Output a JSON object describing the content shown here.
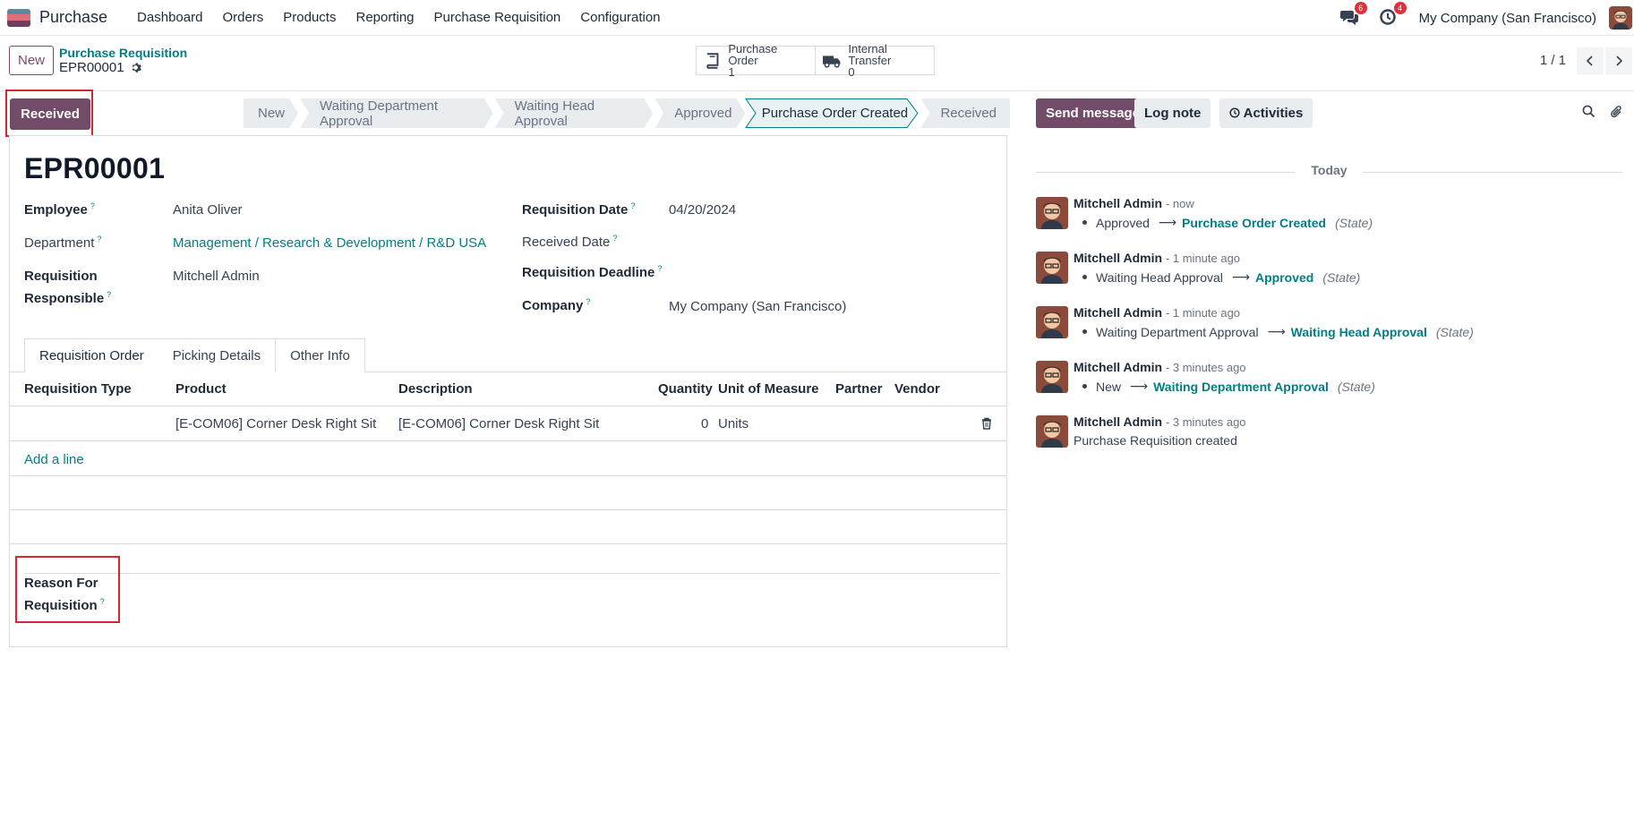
{
  "navbar": {
    "app_name": "Purchase",
    "menu": [
      "Dashboard",
      "Orders",
      "Products",
      "Reporting",
      "Purchase Requisition",
      "Configuration"
    ],
    "messages_count": "6",
    "activities_count": "4",
    "company": "My Company (San Francisco)"
  },
  "control": {
    "new_label": "New",
    "breadcrumb_parent": "Purchase Requisition",
    "breadcrumb_current": "EPR00001",
    "smart_buttons": [
      {
        "label": "Purchase Order",
        "count": "1",
        "icon": "book-icon"
      },
      {
        "label": "Internal Transfer",
        "count": "0",
        "icon": "truck-icon"
      }
    ],
    "pager": "1 / 1"
  },
  "statusbar": {
    "action_label": "Received",
    "stages": [
      "New",
      "Waiting Department Approval",
      "Waiting Head Approval",
      "Approved",
      "Purchase Order Created",
      "Received"
    ],
    "active_stage": "Purchase Order Created"
  },
  "form": {
    "title": "EPR00001",
    "employee_label": "Employee",
    "employee": "Anita Oliver",
    "department_label": "Department",
    "department": "Management / Research & Development / R&D USA",
    "responsible_label_1": "Requisition",
    "responsible_label_2": "Responsible",
    "responsible": "Mitchell Admin",
    "req_date_label": "Requisition Date",
    "req_date": "04/20/2024",
    "received_date_label": "Received Date",
    "deadline_label": "Requisition Deadline",
    "company_label": "Company",
    "company": "My Company (San Francisco)",
    "help_mark": "?",
    "tabs": [
      "Requisition Order",
      "Picking Details",
      "Other Info"
    ],
    "columns": [
      "Requisition Type",
      "Product",
      "Description",
      "Quantity",
      "Unit of Measure",
      "Partner",
      "Vendor"
    ],
    "rows": [
      {
        "type": "",
        "product": "[E-COM06] Corner Desk Right Sit",
        "description": "[E-COM06] Corner Desk Right Sit",
        "quantity": "0",
        "uom": "Units",
        "partner": "",
        "vendor": ""
      }
    ],
    "add_line": "Add a line",
    "reason_label_1": "Reason For",
    "reason_label_2": "Requisition"
  },
  "chatter": {
    "send_message": "Send message",
    "log_note": "Log note",
    "activities": "Activities",
    "today": "Today",
    "messages": [
      {
        "author": "Mitchell Admin",
        "time": "- now",
        "old": "Approved",
        "new": "Purchase Order Created",
        "field": "(State)"
      },
      {
        "author": "Mitchell Admin",
        "time": "- 1 minute ago",
        "old": "Waiting Head Approval",
        "new": "Approved",
        "field": "(State)"
      },
      {
        "author": "Mitchell Admin",
        "time": "- 1 minute ago",
        "old": "Waiting Department Approval",
        "new": "Waiting Head Approval",
        "field": "(State)"
      },
      {
        "author": "Mitchell Admin",
        "time": "- 3 minutes ago",
        "old": "New",
        "new": "Waiting Department Approval",
        "field": "(State)"
      },
      {
        "author": "Mitchell Admin",
        "time": "- 3 minutes ago",
        "text": "Purchase Requisition created"
      }
    ]
  },
  "colors": {
    "brand": "#714b67",
    "link": "#017e84",
    "highlight": "#d9262e"
  }
}
